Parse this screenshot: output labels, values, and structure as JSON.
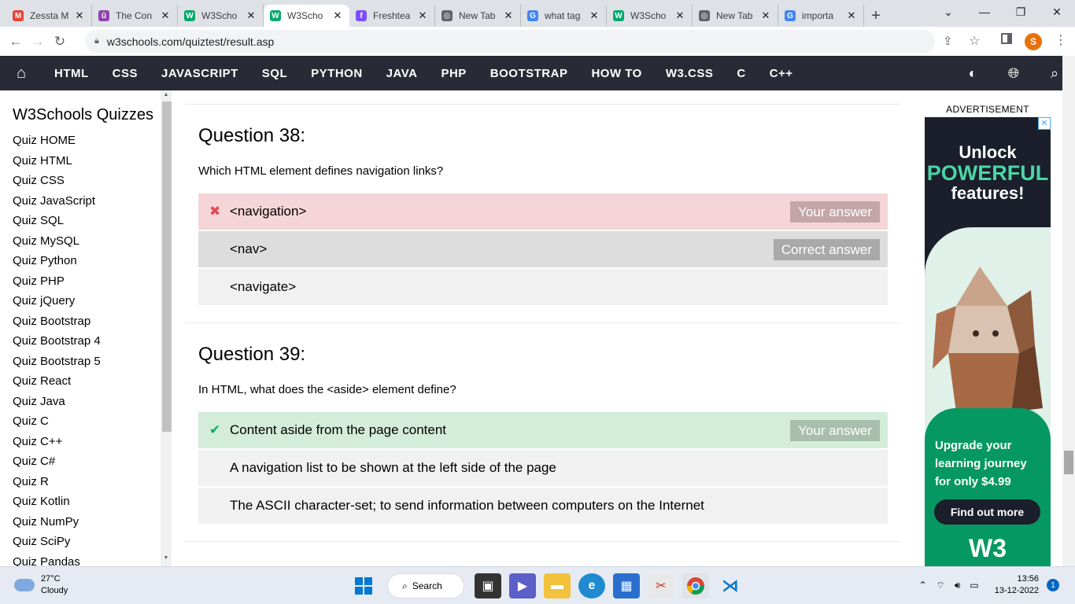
{
  "browser": {
    "tabs": [
      {
        "title": "Zessta M",
        "icon": "gmail-icon",
        "color": "#ea4335",
        "glyph": "M"
      },
      {
        "title": "The Con",
        "icon": "purple-circle-icon",
        "color": "#8e44ad",
        "glyph": "û"
      },
      {
        "title": "W3Scho",
        "icon": "w3schools-icon",
        "color": "#04aa6d",
        "glyph": "W"
      },
      {
        "title": "W3Scho",
        "icon": "w3schools-icon",
        "color": "#04aa6d",
        "glyph": "W",
        "active": true
      },
      {
        "title": "Freshtea",
        "icon": "freshteam-icon",
        "color": "#7c4dff",
        "glyph": "f"
      },
      {
        "title": "New Tab",
        "icon": "chrome-icon",
        "color": "#5f6368",
        "glyph": "◎"
      },
      {
        "title": "what tag",
        "icon": "google-icon",
        "color": "#4285f4",
        "glyph": "G"
      },
      {
        "title": "W3Scho",
        "icon": "w3schools-icon",
        "color": "#04aa6d",
        "glyph": "W"
      },
      {
        "title": "New Tab",
        "icon": "chrome-icon",
        "color": "#5f6368",
        "glyph": "◎"
      },
      {
        "title": "importa",
        "icon": "google-icon",
        "color": "#4285f4",
        "glyph": "G"
      }
    ],
    "new_tab": "+",
    "window_controls": {
      "dropdown": "⌄",
      "minimize": "—",
      "maximize": "❐",
      "close": "✕"
    },
    "url": "w3schools.com/quiztest/result.asp",
    "profile_initial": "S"
  },
  "w3nav": {
    "items": [
      "HTML",
      "CSS",
      "JAVASCRIPT",
      "SQL",
      "PYTHON",
      "JAVA",
      "PHP",
      "BOOTSTRAP",
      "HOW TO",
      "W3.CSS",
      "C",
      "C++"
    ]
  },
  "sidebar": {
    "title": "W3Schools Quizzes",
    "items": [
      "Quiz HOME",
      "Quiz HTML",
      "Quiz CSS",
      "Quiz JavaScript",
      "Quiz SQL",
      "Quiz MySQL",
      "Quiz Python",
      "Quiz PHP",
      "Quiz jQuery",
      "Quiz Bootstrap",
      "Quiz Bootstrap 4",
      "Quiz Bootstrap 5",
      "Quiz React",
      "Quiz Java",
      "Quiz C",
      "Quiz C++",
      "Quiz C#",
      "Quiz R",
      "Quiz Kotlin",
      "Quiz NumPy",
      "Quiz SciPy",
      "Quiz Pandas"
    ]
  },
  "questions": [
    {
      "title": "Question 38:",
      "text": "Which HTML element defines navigation links?",
      "answers": [
        {
          "text": "<navigation>",
          "state": "wrong",
          "mark": "✖",
          "tag": "Your answer"
        },
        {
          "text": "<nav>",
          "state": "correct",
          "mark": "",
          "tag": "Correct answer"
        },
        {
          "text": "<navigate>",
          "state": "none",
          "mark": "",
          "tag": ""
        }
      ]
    },
    {
      "title": "Question 39:",
      "text": "In HTML, what does the <aside> element define?",
      "answers": [
        {
          "text": "Content aside from the page content",
          "state": "right",
          "mark": "✔",
          "tag": "Your answer"
        },
        {
          "text": "A navigation list to be shown at the left side of the page",
          "state": "none",
          "mark": "",
          "tag": ""
        },
        {
          "text": "The ASCII character-set; to send information between computers on the Internet",
          "state": "none",
          "mark": "",
          "tag": ""
        }
      ]
    }
  ],
  "ad": {
    "label": "ADVERTISEMENT",
    "close": "✕",
    "line1": "Unlock",
    "line2": "POWERFUL",
    "line3": "features!",
    "upgrade": "Upgrade your learning journey for only $4.99",
    "button": "Find out more",
    "logo": "W3"
  },
  "taskbar": {
    "temperature": "27°C",
    "condition": "Cloudy",
    "search": "Search",
    "time": "13:56",
    "date": "13-12-2022",
    "notifications": "1"
  }
}
